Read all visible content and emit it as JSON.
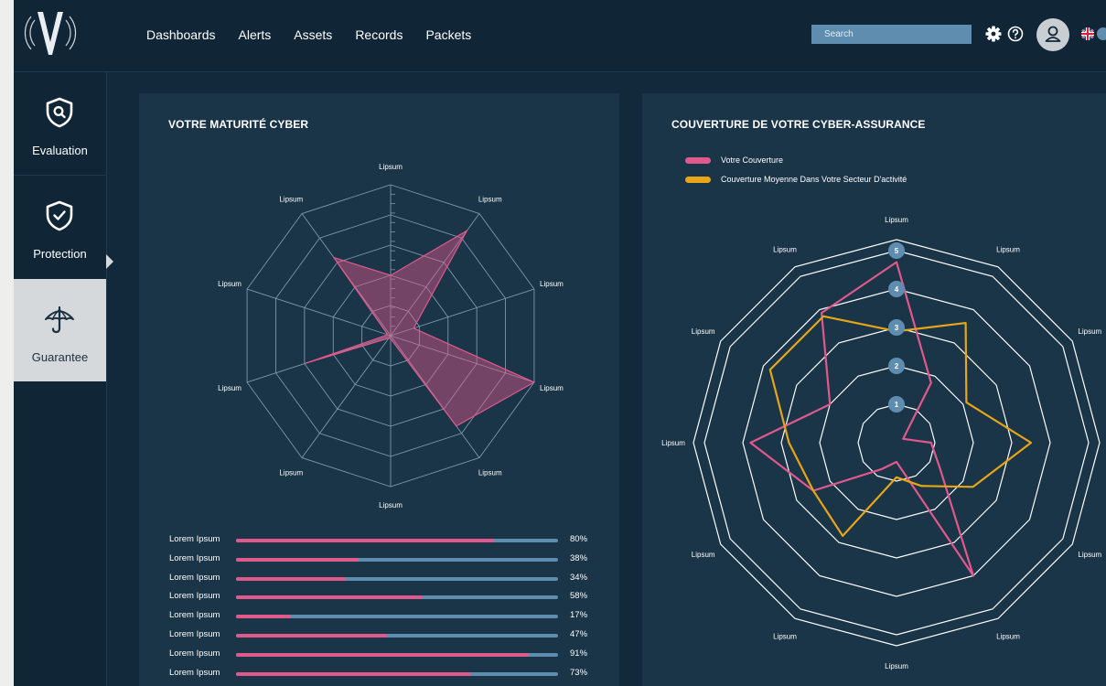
{
  "nav": [
    "Dashboards",
    "Alerts",
    "Assets",
    "Records",
    "Packets"
  ],
  "search": {
    "placeholder": "Search"
  },
  "icons": {
    "logo": "shield-v-logo",
    "settings": "gear-icon",
    "help": "help-circle-icon",
    "avatar": "user-icon",
    "language": "uk-flag-icon"
  },
  "sidebar": {
    "items": [
      {
        "label": "Evaluation",
        "icon": "search-shield-icon"
      },
      {
        "label": "Protection",
        "icon": "check-shield-icon"
      },
      {
        "label": "Guarantee",
        "icon": "umbrella-icon",
        "active": true
      }
    ]
  },
  "colors": {
    "accent_pink": "#e0598c",
    "accent_gold": "#e6a617",
    "track_blue": "#5e8db0",
    "panel": "#1a3448",
    "background": "#12293b"
  },
  "left_panel": {
    "title": "VOTRE MATURITÉ CYBER",
    "progress": [
      {
        "label": "Lorem Ipsum",
        "value": 80,
        "text": "80%"
      },
      {
        "label": "Lorem Ipsum",
        "value": 38,
        "text": "38%"
      },
      {
        "label": "Lorem Ipsum",
        "value": 34,
        "text": "34%"
      },
      {
        "label": "Lorem Ipsum",
        "value": 58,
        "text": "58%"
      },
      {
        "label": "Lorem Ipsum",
        "value": 17,
        "text": "17%"
      },
      {
        "label": "Lorem Ipsum",
        "value": 47,
        "text": "47%"
      },
      {
        "label": "Lorem Ipsum",
        "value": 91,
        "text": "91%"
      },
      {
        "label": "Lorem Ipsum",
        "value": 73,
        "text": "73%"
      }
    ]
  },
  "right_panel": {
    "title": "COUVERTURE DE VOTRE CYBER-ASSURANCE",
    "legend": [
      {
        "label": "Votre Couverture",
        "color": "#e0598c"
      },
      {
        "label": "Couverture Moyenne Dans Votre Secteur D'activité",
        "color": "#e6a617"
      }
    ]
  },
  "chart_data": [
    {
      "type": "radar",
      "title": "VOTRE MATURITÉ CYBER",
      "axes": [
        "Lipsum",
        "Lipsum",
        "Lipsum",
        "Lipsum",
        "Lipsum",
        "Lipsum",
        "Lipsum",
        "Lipsum",
        "Lipsum",
        "Lipsum"
      ],
      "range": [
        0,
        5
      ],
      "series": [
        {
          "values": [
            2.0,
            4.3,
            0.8,
            5.0,
            3.7,
            0.1,
            0.1,
            3.0,
            0.1,
            3.2
          ],
          "color": "#e0598c"
        }
      ]
    },
    {
      "type": "radar",
      "title": "COUVERTURE DE VOTRE CYBER-ASSURANCE",
      "axes": [
        "Lipsum",
        "Lipsum",
        "Lipsum",
        "Lipsum",
        "Lipsum",
        "Lipsum",
        "Lipsum",
        "Lipsum",
        "Lipsum",
        "Lipsum",
        "Lipsum",
        "Lipsum"
      ],
      "ticks": [
        "1",
        "2",
        "3",
        "4",
        "5"
      ],
      "range": [
        0,
        5
      ],
      "series": [
        {
          "name": "Votre Couverture",
          "color": "#e0598c",
          "values": [
            4.7,
            1.8,
            0.2,
            0.9,
            1.3,
            4.0,
            0.5,
            0.8,
            2.5,
            3.8,
            2.0,
            3.9
          ]
        },
        {
          "name": "Couverture Moyenne Dans Votre Secteur D'activité",
          "color": "#e6a617",
          "values": [
            2.9,
            3.6,
            2.1,
            3.5,
            2.3,
            1.3,
            0.9,
            2.8,
            2.5,
            2.8,
            3.8,
            3.8
          ]
        }
      ]
    }
  ]
}
